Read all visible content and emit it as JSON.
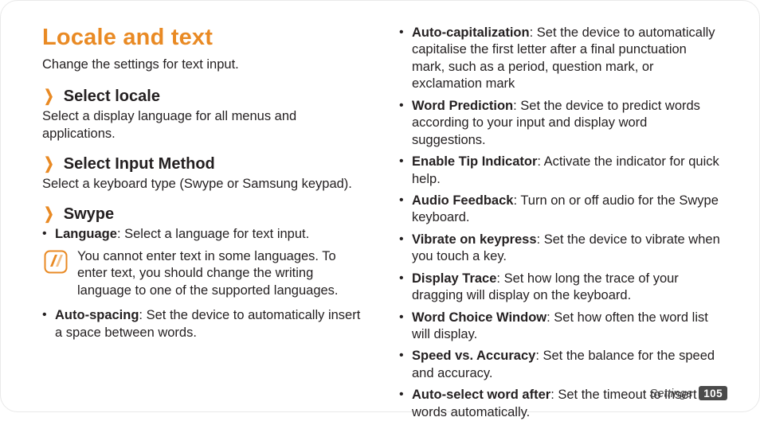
{
  "title": "Locale and text",
  "intro": "Change the settings for text input.",
  "sections": [
    {
      "heading": "Select locale",
      "desc": "Select a display language for all menus and applications."
    },
    {
      "heading": "Select Input Method",
      "desc": "Select a keyboard type (Swype or Samsung keypad)."
    },
    {
      "heading": "Swype"
    }
  ],
  "swype_col1": [
    {
      "term": "Language",
      "desc": ": Select a language for text input."
    }
  ],
  "note": "You cannot enter text in some languages. To enter text, you should change the writing language to one of the supported languages.",
  "swype_col1b": [
    {
      "term": "Auto-spacing",
      "desc": ": Set the device to automatically insert a space between words."
    }
  ],
  "swype_col2": [
    {
      "term": "Auto-capitalization",
      "desc": ": Set the device to automatically capitalise the first letter after a final punctuation mark, such as a period, question mark, or exclamation mark"
    },
    {
      "term": "Word Prediction",
      "desc": ": Set the device to predict words according to your input and display word suggestions."
    },
    {
      "term": "Enable Tip Indicator",
      "desc": ": Activate the indicator for quick help."
    },
    {
      "term": "Audio Feedback",
      "desc": ": Turn on or off audio for the Swype keyboard."
    },
    {
      "term": "Vibrate on keypress",
      "desc": ": Set the device to vibrate when you touch a key."
    },
    {
      "term": "Display Trace",
      "desc": ": Set how long the trace of your dragging will display on the keyboard."
    },
    {
      "term": "Word Choice Window",
      "desc": ": Set how often the word list will display."
    },
    {
      "term": "Speed vs. Accuracy",
      "desc": ": Set the balance for the speed and accuracy."
    },
    {
      "term": "Auto-select word after",
      "desc": ": Set the timeout to insert words automatically."
    }
  ],
  "footer": {
    "section": "Settings",
    "page": "105"
  }
}
